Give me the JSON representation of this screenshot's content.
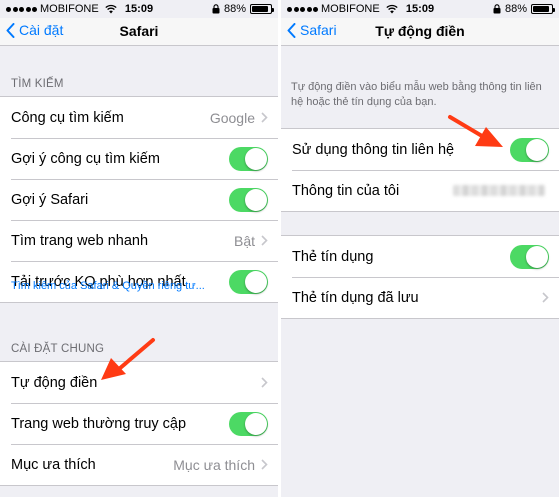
{
  "left": {
    "status": {
      "carrier": "MOBIFONE",
      "time": "15:09",
      "battery": "88%",
      "battery_level": 0.88
    },
    "nav": {
      "back_label": "Cài đặt",
      "title": "Safari"
    },
    "search_section": {
      "header": "TÌM KIẾM",
      "rows": [
        {
          "label": "Công cụ tìm kiếm",
          "value": "Google"
        },
        {
          "label": "Gợi ý công cụ tìm kiếm",
          "toggle": true
        },
        {
          "label": "Gợi ý Safari",
          "toggle": true
        },
        {
          "label": "Tìm trang web nhanh",
          "value": "Bật"
        },
        {
          "label": "Tải trước KQ phù hợp nhất",
          "toggle": true
        }
      ],
      "footer_link": "Tìm kiếm của Safari & Quyền riêng tư..."
    },
    "general_section": {
      "header": "CÀI ĐẶT CHUNG",
      "rows": [
        {
          "label": "Tự động điền"
        },
        {
          "label": "Trang web thường truy cập",
          "toggle": true
        },
        {
          "label": "Mục ưa thích",
          "value": "Mục ưa thích"
        }
      ]
    }
  },
  "right": {
    "status": {
      "carrier": "MOBIFONE",
      "time": "15:09",
      "battery": "88%",
      "battery_level": 0.88
    },
    "nav": {
      "back_label": "Safari",
      "title": "Tự động điền"
    },
    "description": "Tự động điền vào biểu mẫu web bằng thông tin liên hệ hoặc thẻ tín dụng của bạn.",
    "contact_section": {
      "rows": [
        {
          "label": "Sử dụng thông tin liên hệ",
          "toggle": true
        },
        {
          "label": "Thông tin của tôi"
        }
      ]
    },
    "card_section": {
      "rows": [
        {
          "label": "Thẻ tín dụng",
          "toggle": true
        },
        {
          "label": "Thẻ tín dụng đã lưu"
        }
      ]
    }
  },
  "colors": {
    "accent": "#007aff",
    "toggle_on": "#4cd964",
    "background": "#efeff4",
    "separator": "#c8c7cc",
    "secondary_text": "#8e8e93",
    "annotation_arrow": "#ff3b14"
  },
  "icons": [
    "signal-dots-icon",
    "wifi-icon",
    "lock-rotation-icon",
    "battery-icon",
    "chevron-left-icon",
    "chevron-right-icon",
    "annotation-arrow-icon"
  ]
}
